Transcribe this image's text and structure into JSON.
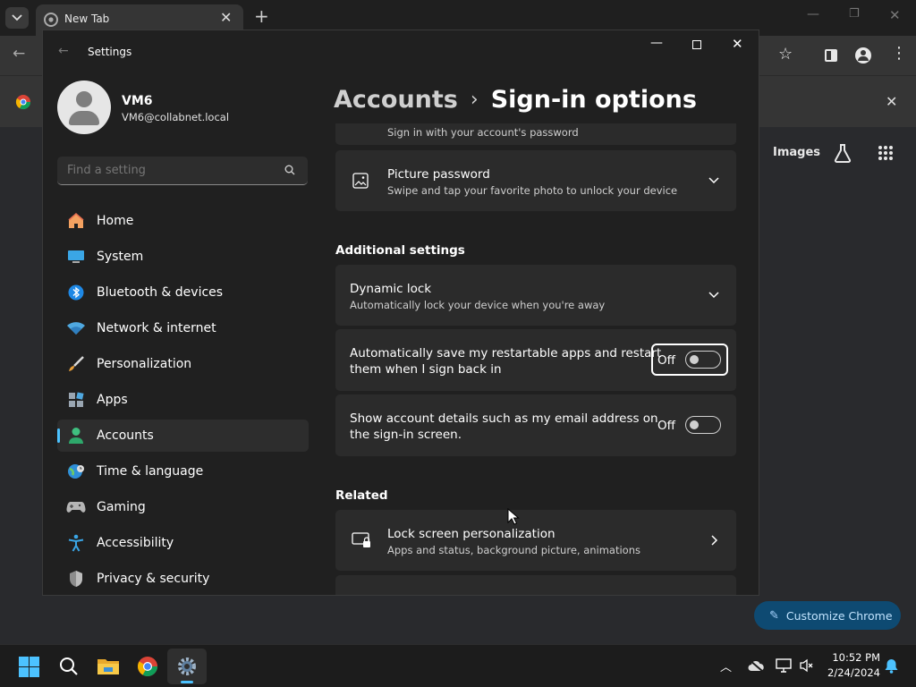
{
  "chrome": {
    "tab_title": "New Tab",
    "top_links": [
      "Images"
    ],
    "customize_button": "Customize Chrome"
  },
  "settings": {
    "title": "Settings",
    "user": {
      "name": "VM6",
      "email": "VM6@collabnet.local"
    },
    "search": {
      "placeholder": "Find a setting"
    },
    "nav": [
      {
        "label": "Home"
      },
      {
        "label": "System"
      },
      {
        "label": "Bluetooth & devices"
      },
      {
        "label": "Network & internet"
      },
      {
        "label": "Personalization"
      },
      {
        "label": "Apps"
      },
      {
        "label": "Accounts",
        "selected": true
      },
      {
        "label": "Time & language"
      },
      {
        "label": "Gaming"
      },
      {
        "label": "Accessibility"
      },
      {
        "label": "Privacy & security"
      }
    ],
    "breadcrumb": {
      "parent": "Accounts",
      "separator": "›",
      "current": "Sign-in options"
    },
    "partial_item_subtitle": "Sign in with your account's password",
    "picture_password": {
      "title": "Picture password",
      "subtitle": "Swipe and tap your favorite photo to unlock your device"
    },
    "additional_heading": "Additional settings",
    "dynamic_lock": {
      "title": "Dynamic lock",
      "subtitle": "Automatically lock your device when you're away"
    },
    "auto_save": {
      "line1": "Automatically save my restartable apps and restart",
      "line2": "them when I sign back in",
      "state": "Off"
    },
    "show_details": {
      "line1": "Show account details such as my email address on",
      "line2": "the sign-in screen.",
      "state": "Off"
    },
    "related_heading": "Related",
    "lock_screen": {
      "title": "Lock screen personalization",
      "subtitle": "Apps and status, background picture, animations"
    }
  },
  "taskbar": {
    "time": "10:52 PM",
    "date": "2/24/2024"
  },
  "colors": {
    "accent": "#4cc2ff",
    "window_bg": "#202020",
    "card_bg": "#2b2b2b",
    "selected_nav": "#2d2d2d"
  }
}
